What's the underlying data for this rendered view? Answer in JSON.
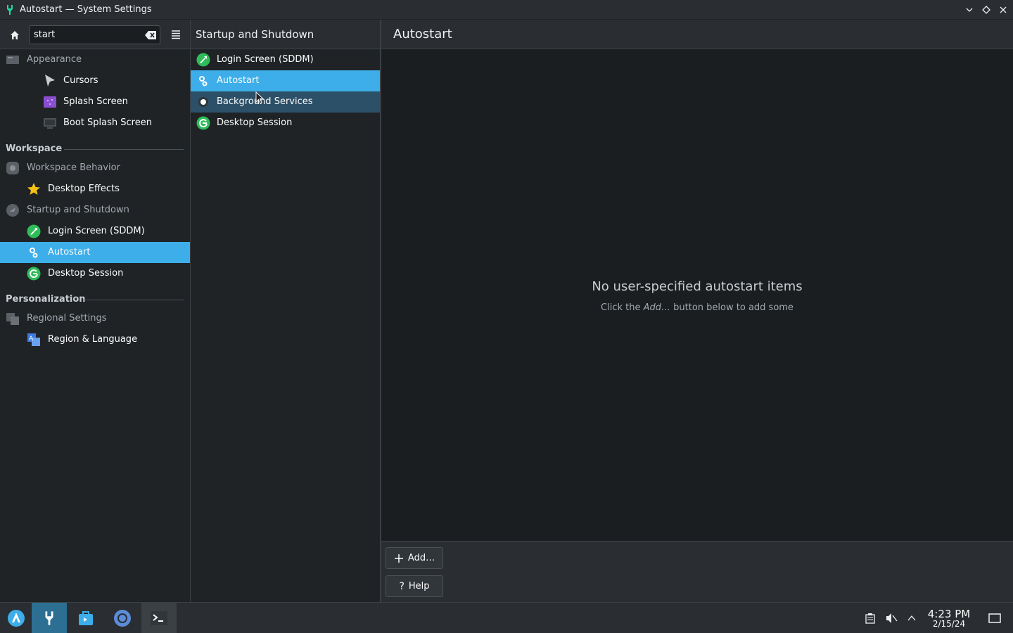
{
  "window": {
    "title": "Autostart — System Settings"
  },
  "search": {
    "value": "start"
  },
  "header": {
    "middle_title": "Startup and Shutdown",
    "right_title": "Autostart"
  },
  "sidebar": {
    "items": [
      {
        "label": "Appearance",
        "kind": "category",
        "icon": "appearance-icon"
      },
      {
        "label": "Cursors",
        "kind": "sub2",
        "icon": "cursor-icon"
      },
      {
        "label": "Splash Screen",
        "kind": "sub2",
        "icon": "splash-icon"
      },
      {
        "label": "Boot Splash Screen",
        "kind": "sub2",
        "icon": "monitor-icon"
      },
      {
        "label": "Workspace Behavior",
        "kind": "category",
        "icon": "workspace-icon"
      },
      {
        "label": "Desktop Effects",
        "kind": "sub",
        "icon": "star-icon"
      },
      {
        "label": "Startup and Shutdown",
        "kind": "category",
        "icon": "startup-icon"
      },
      {
        "label": "Login Screen (SDDM)",
        "kind": "sub",
        "icon": "login-icon"
      },
      {
        "label": "Autostart",
        "kind": "sub",
        "icon": "autostart-icon",
        "selected": true
      },
      {
        "label": "Desktop Session",
        "kind": "sub",
        "icon": "session-icon"
      },
      {
        "label": "Regional Settings",
        "kind": "category",
        "icon": "regional-icon"
      },
      {
        "label": "Region & Language",
        "kind": "sub",
        "icon": "language-icon"
      }
    ],
    "sections": [
      "Workspace",
      "Personalization"
    ]
  },
  "middle_list": {
    "items": [
      {
        "label": "Login Screen (SDDM)",
        "icon": "login-icon"
      },
      {
        "label": "Autostart",
        "icon": "autostart-icon",
        "selected": true
      },
      {
        "label": "Background Services",
        "icon": "services-icon",
        "hover": true
      },
      {
        "label": "Desktop Session",
        "icon": "session-icon"
      }
    ]
  },
  "main": {
    "empty_title": "No user-specified autostart items",
    "empty_sub_prefix": "Click the ",
    "empty_sub_emph": "Add…",
    "empty_sub_suffix": " button below to add some",
    "add_button": "Add…",
    "help_button": "Help"
  },
  "taskbar": {
    "time": "4:23 PM",
    "date": "2/15/24"
  },
  "colors": {
    "accent": "#3daee9",
    "panel": "#2a2e32",
    "background": "#1b1e20",
    "green": "#2ebd59"
  }
}
